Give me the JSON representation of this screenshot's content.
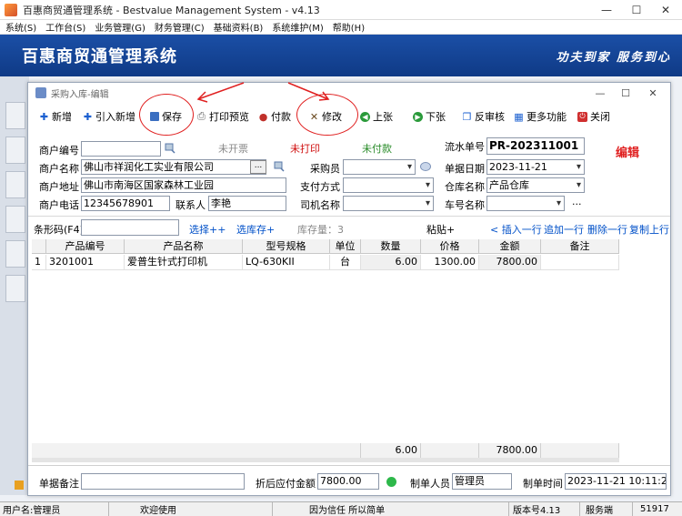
{
  "app": {
    "title": "百惠商贸通管理系统 - Bestvalue Management System - v4.13",
    "menu": [
      "系统(S)",
      "工作台(S)",
      "业务管理(G)",
      "财务管理(C)",
      "基础资料(B)",
      "系统维护(M)",
      "帮助(H)"
    ],
    "banner_title": "百惠商贸通管理系统",
    "banner_slogan": "功夫到家 服务到心"
  },
  "window": {
    "title": "采购入库-编辑",
    "toolbar": [
      "新增",
      "引入新增",
      "保存",
      "打印预览",
      "付款",
      "修改",
      "上张",
      "下张",
      "反审核",
      "更多功能",
      "关闭"
    ]
  },
  "form": {
    "merchant_code_label": "商户编号",
    "merchant_code": "",
    "invoice_status": "未开票",
    "print_status": "未打印",
    "pay_status": "未付款",
    "serial_label": "流水单号",
    "serial_value": "PR-202311001",
    "mode_label": "编辑",
    "merchant_name_label": "商户名称",
    "merchant_name": "佛山市祥润化工实业有限公司",
    "buyer_label": "采购员",
    "buyer": "",
    "date_label": "单据日期",
    "date": "2023-11-21",
    "address_label": "商户地址",
    "address": "佛山市南海区国家森林工业园",
    "pay_method_label": "支付方式",
    "pay_method": "",
    "warehouse_label": "仓库名称",
    "warehouse": "产品仓库",
    "phone_label": "商户电话",
    "phone": "12345678901",
    "contact_label": "联系人",
    "contact": "李艳",
    "driver_label": "司机名称",
    "driver": "",
    "plate_label": "车号名称",
    "plate": "",
    "barcode_label": "条形码(F4)",
    "barcode": "",
    "select_link": "选择++",
    "select_stock_link": "选库存+",
    "stock_label": "库存量：3",
    "paste_label": "粘贴+",
    "insert_row": "< 插入一行",
    "append_row": "追加一行",
    "delete_row": "删除一行",
    "copy_row": "复制上行"
  },
  "table": {
    "headers": [
      "产品编号",
      "产品名称",
      "型号规格",
      "单位",
      "数量",
      "价格",
      "金额",
      "备注"
    ],
    "rows": [
      {
        "idx": "1",
        "code": "3201001",
        "name": "爱普生针式打印机",
        "spec": "LQ-630KII",
        "unit": "台",
        "qty": "6.00",
        "price": "1300.00",
        "amount": "7800.00",
        "note": ""
      }
    ],
    "total_qty": "6.00",
    "total_amount": "7800.00"
  },
  "footer": {
    "note_label": "单据备注",
    "note": "",
    "discount_label": "折后应付金额",
    "discount_value": "7800.00",
    "maker_label": "制单人员",
    "maker": "管理员",
    "time_label": "制单时间",
    "time": "2023-11-21 10:11:29"
  },
  "status": {
    "user": "用户名:管理员",
    "welcome": "欢迎使用",
    "motto": "因为信任 所以简单",
    "version": "版本号4.13",
    "service": "服务端",
    "code": "51917"
  },
  "colors": {
    "banner": "#1b4fa6",
    "status_green": "#2a8c2a",
    "status_red": "#d01010",
    "mode_red": "#e02020",
    "link_blue": "#0050c8"
  }
}
